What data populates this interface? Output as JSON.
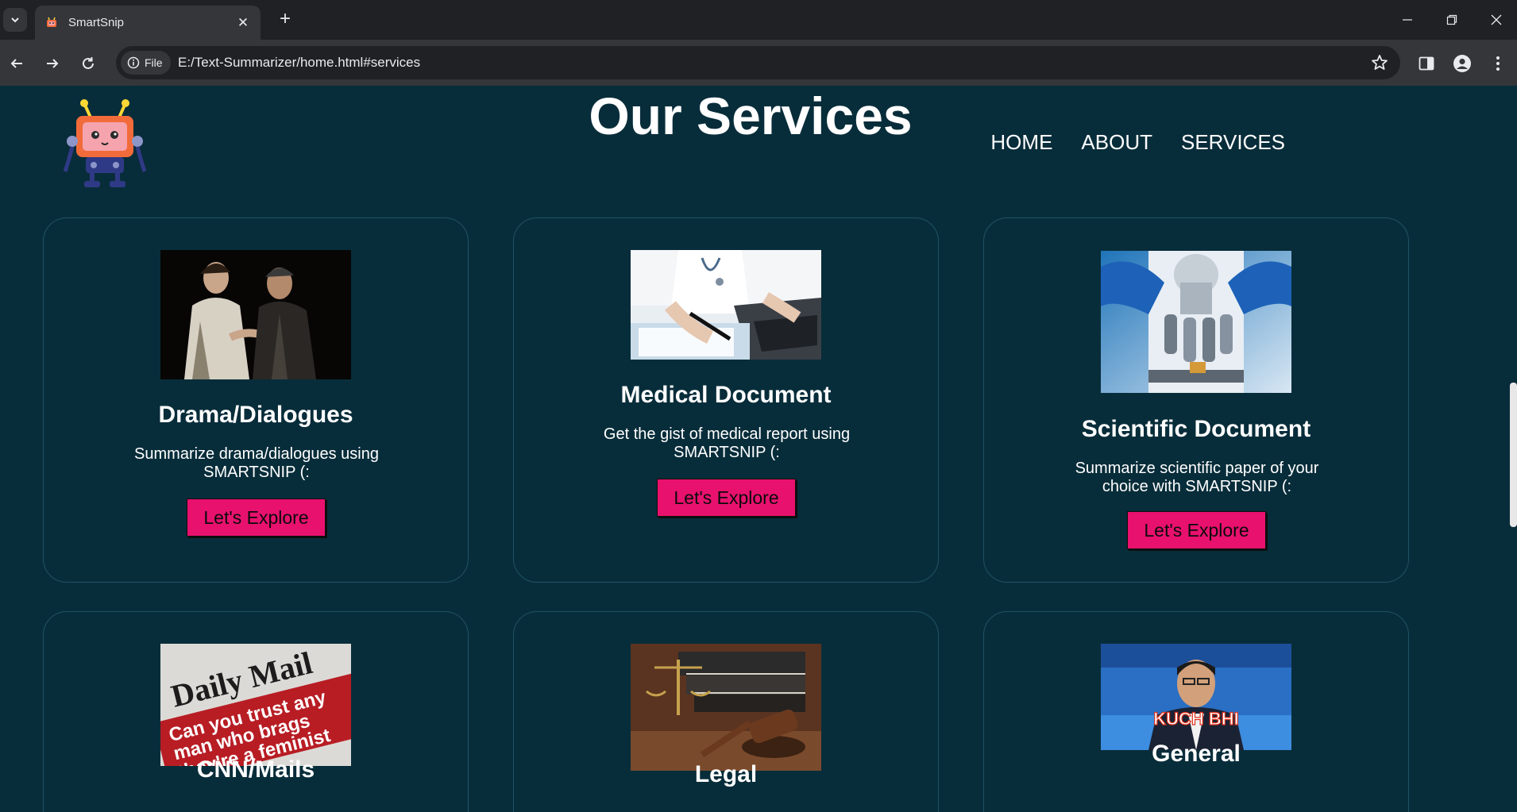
{
  "browser": {
    "tab_title": "SmartSnip",
    "chip_label": "File",
    "url": "E:/Text-Summarizer/home.html#services"
  },
  "header": {
    "title": "Our Services",
    "nav": [
      "HOME",
      "ABOUT",
      "SERVICES"
    ]
  },
  "cards": [
    {
      "title": "Drama/Dialogues",
      "desc": "Summarize drama/dialogues using SMARTSNIP (:",
      "button": "Let's Explore",
      "image": "drama-photo"
    },
    {
      "title": "Medical Document",
      "desc": "Get the gist of medical report using SMARTSNIP (:",
      "button": "Let's Explore",
      "image": "doctor-photo"
    },
    {
      "title": "Scientific Document",
      "desc": "Summarize scientific paper of your choice with SMARTSNIP (:",
      "button": "Let's Explore",
      "image": "microscope-photo"
    },
    {
      "title": "CNN/Mails",
      "image": "newspaper-photo",
      "image_text_1": "Daily Mail",
      "image_text_2": "Can you trust any man who brags they're a feminist"
    },
    {
      "title": "Legal",
      "image": "gavel-photo"
    },
    {
      "title": "General",
      "image": "news-anchor-photo",
      "image_text": "KUCH BHI"
    }
  ]
}
